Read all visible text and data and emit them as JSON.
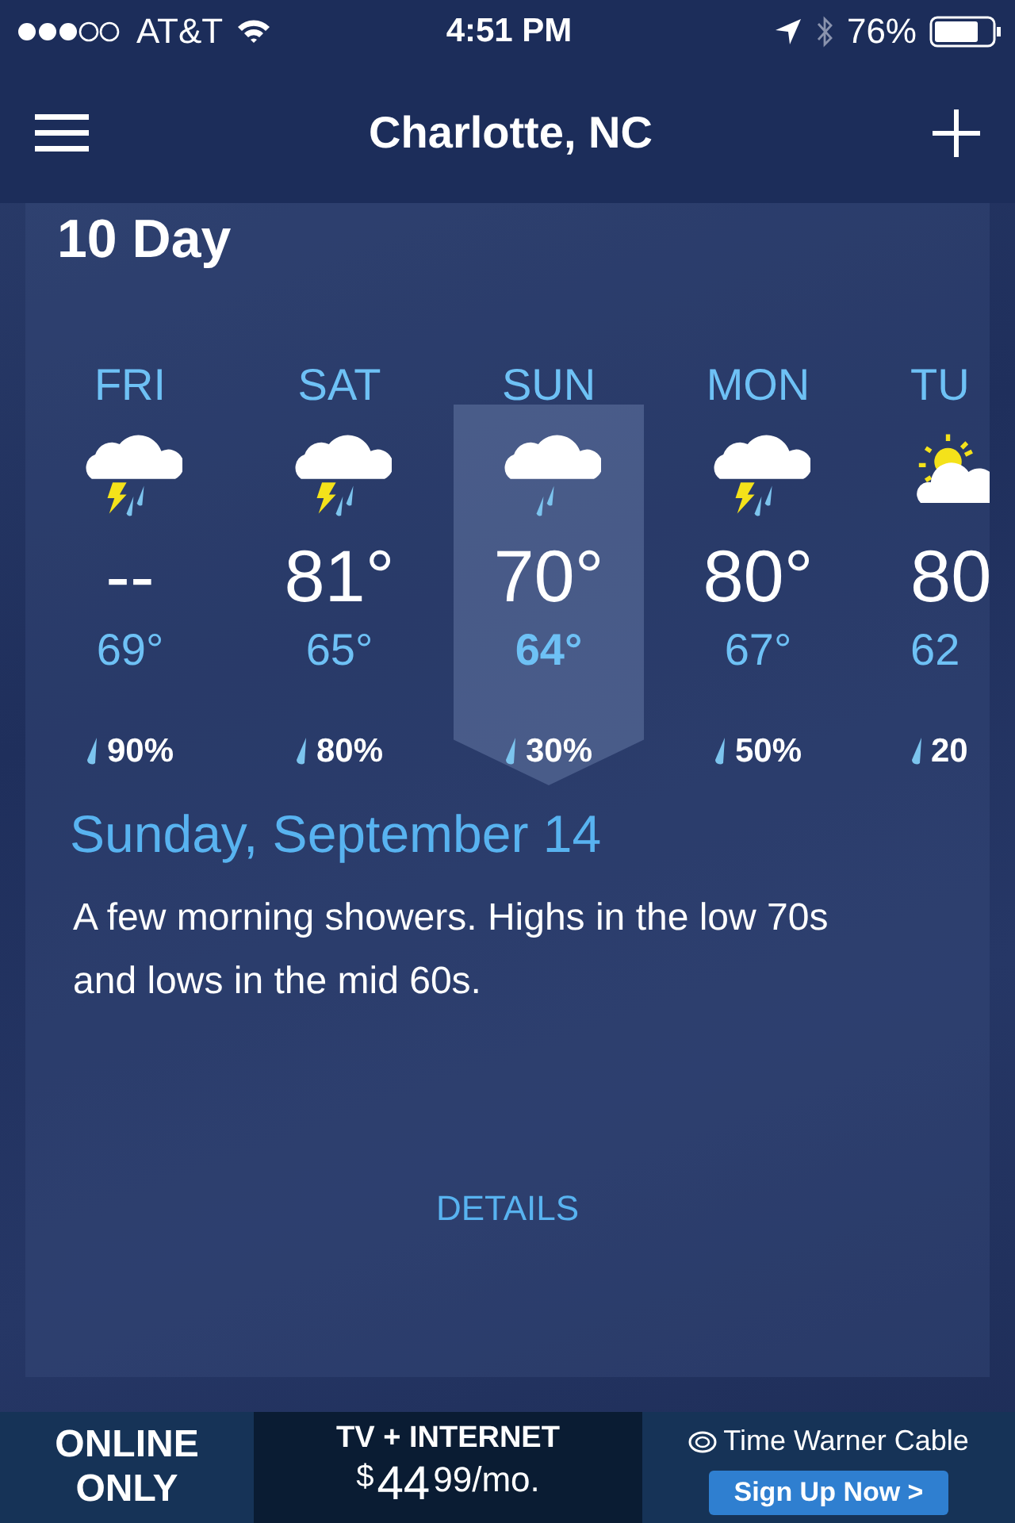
{
  "status_bar": {
    "carrier": "AT&T",
    "time": "4:51 PM",
    "battery": "76%"
  },
  "nav": {
    "title": "Charlotte, NC"
  },
  "section_title": "10 Day",
  "days": [
    {
      "day": "FRI",
      "kind": "thunderstorm",
      "high": "--",
      "low": "69°",
      "precip": "90%",
      "selected": false
    },
    {
      "day": "SAT",
      "kind": "thunderstorm",
      "high": "81°",
      "low": "65°",
      "precip": "80%",
      "selected": false
    },
    {
      "day": "SUN",
      "kind": "rain",
      "high": "70°",
      "low": "64°",
      "precip": "30%",
      "selected": true
    },
    {
      "day": "MON",
      "kind": "thunderstorm",
      "high": "80°",
      "low": "67°",
      "precip": "50%",
      "selected": false
    },
    {
      "day": "TU",
      "kind": "partly_sunny",
      "high": "80",
      "low": "62",
      "precip": "20",
      "selected": false
    }
  ],
  "detail": {
    "date": "Sunday, September 14",
    "summary": "A few morning showers. Highs in the low 70s and lows in the mid 60s."
  },
  "details_link": "DETAILS",
  "ad": {
    "badge_lines": [
      "ONLINE",
      "ONLY"
    ],
    "headline": "TV + INTERNET",
    "currency": "$",
    "price": "44",
    "cents": "99/mo.",
    "brand": "Time Warner Cable",
    "cta": "Sign Up Now >"
  }
}
